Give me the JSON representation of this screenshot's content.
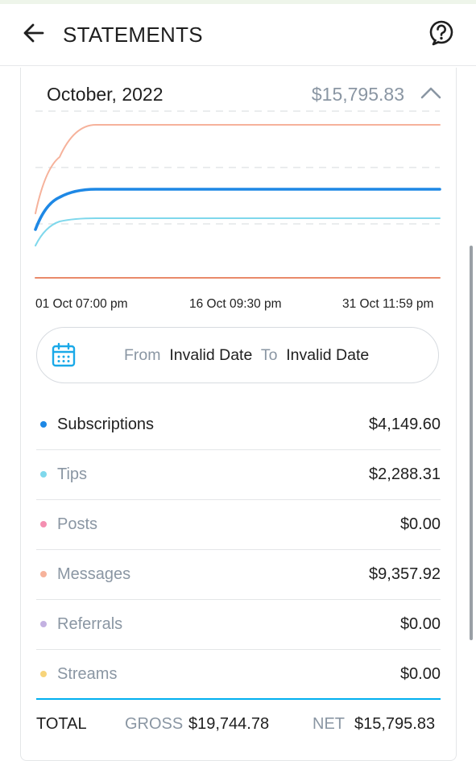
{
  "header": {
    "title": "STATEMENTS",
    "back_icon": "arrow-left-icon",
    "help_icon": "help-circle-icon"
  },
  "statement": {
    "month": "October, 2022",
    "total": "$15,795.83",
    "collapse_icon": "chevron-up-icon"
  },
  "chart_data": {
    "type": "line",
    "x": [
      "01 Oct 07:00 pm",
      "16 Oct 09:30 pm",
      "31 Oct 11:59 pm"
    ],
    "x_ticks": [
      "01 Oct 07:00 pm",
      "16 Oct 09:30 pm",
      "31 Oct 11:59 pm"
    ],
    "grid": "dashed horizontal",
    "series": [
      {
        "name": "Messages",
        "color": "#f6b29b",
        "values": [
          40,
          75,
          95,
          95
        ]
      },
      {
        "name": "Subscriptions",
        "color": "#1e88e5",
        "values": [
          30,
          50,
          55,
          55
        ]
      },
      {
        "name": "Tips",
        "color": "#7fd8ec",
        "values": [
          20,
          35,
          37,
          37
        ]
      },
      {
        "name": "Posts",
        "color": "#e98a6a",
        "values": [
          0,
          0,
          0,
          0
        ]
      }
    ]
  },
  "date_range": {
    "icon": "calendar-icon",
    "from_label": "From",
    "from_value": "Invalid Date",
    "to_label": "To",
    "to_value": "Invalid Date"
  },
  "breakdown": [
    {
      "label": "Subscriptions",
      "value": "$4,149.60",
      "color": "#1e88e5"
    },
    {
      "label": "Tips",
      "value": "$2,288.31",
      "color": "#7fd8ec"
    },
    {
      "label": "Posts",
      "value": "$0.00",
      "color": "#f48fb1"
    },
    {
      "label": "Messages",
      "value": "$9,357.92",
      "color": "#f6b29b"
    },
    {
      "label": "Referrals",
      "value": "$0.00",
      "color": "#c3b1e1"
    },
    {
      "label": "Streams",
      "value": "$0.00",
      "color": "#f7d47a"
    }
  ],
  "totals": {
    "label": "TOTAL",
    "gross_label": "GROSS",
    "gross_value": "$19,744.78",
    "net_label": "NET",
    "net_value": "$15,795.83"
  }
}
